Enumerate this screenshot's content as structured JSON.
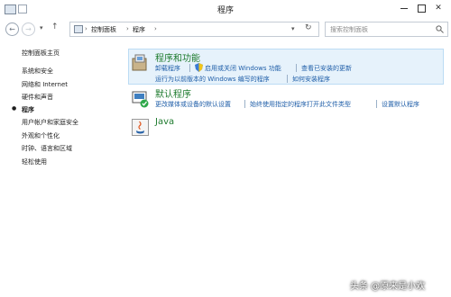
{
  "window": {
    "title": "程序"
  },
  "address": {
    "breadcrumb": [
      "控制面板",
      "程序"
    ],
    "search_placeholder": "搜索控制面板"
  },
  "sidebar": {
    "home": "控制面板主页",
    "items": [
      {
        "label": "系统和安全",
        "active": false
      },
      {
        "label": "网络和 Internet",
        "active": false
      },
      {
        "label": "硬件和声音",
        "active": false
      },
      {
        "label": "程序",
        "active": true
      },
      {
        "label": "用户帐户和家庭安全",
        "active": false
      },
      {
        "label": "外观和个性化",
        "active": false
      },
      {
        "label": "时钟、语言和区域",
        "active": false
      },
      {
        "label": "轻松使用",
        "active": false
      }
    ]
  },
  "categories": [
    {
      "title": "程序和功能",
      "links_row1": [
        "卸载程序",
        "启用或关闭 Windows 功能",
        "查看已安装的更新"
      ],
      "links_row2": [
        "运行为以前版本的 Windows 编写的程序",
        "如何安装程序"
      ]
    },
    {
      "title": "默认程序",
      "links_row1": [
        "更改媒体或设备的默认设置",
        "始终使用指定的程序打开此文件类型",
        "设置默认程序"
      ]
    },
    {
      "title": "Java"
    }
  ],
  "watermark": "头条 @原来是小欢",
  "colors": {
    "category_title": "#1e7b2e",
    "link": "#1f5ea8",
    "highlight": "#e6f2fb"
  }
}
